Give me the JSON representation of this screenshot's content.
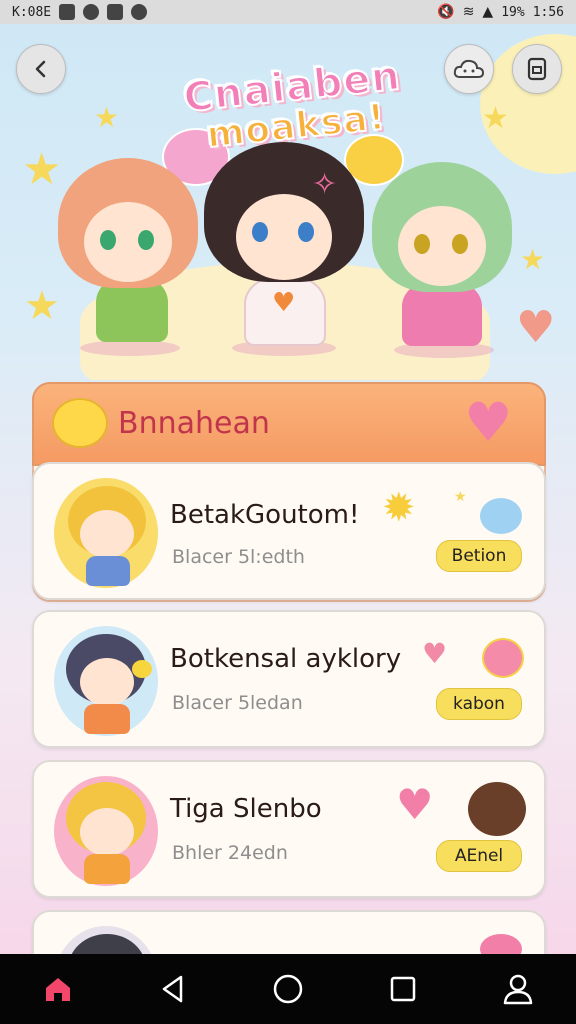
{
  "status_bar": {
    "time_left": "K:08E",
    "battery": "19%",
    "clock": "1:56"
  },
  "header": {
    "title_line1": "Cnaiaben",
    "title_line2": "moaksa!",
    "back_icon": "back-arrow-icon",
    "cloud_icon": "cloud-icon",
    "menu_icon": "document-icon"
  },
  "section": {
    "title": "Bnnahean",
    "heart_icon": "heart-icon"
  },
  "cards": [
    {
      "title": "BetakGoutom!",
      "subtitle": "Blacer 5l:edth",
      "button": "Betion",
      "avatar_color": "#f7d24a"
    },
    {
      "title": "Botkensal ayklory",
      "subtitle": "Blacer 5ledan",
      "button": "kabon",
      "avatar_color": "#bfe4f6"
    },
    {
      "title": "Tiga Slenbo",
      "subtitle": "Bhler 24edn",
      "button": "AEnel",
      "avatar_color": "#f7a9c6"
    }
  ],
  "colors": {
    "accent_pink": "#f27fa8",
    "accent_orange": "#f59a63",
    "button_yellow": "#f8de5d"
  },
  "nav": {
    "home_icon": "home-icon",
    "back_icon": "triangle-back-icon",
    "circle_icon": "home-circle-icon",
    "square_icon": "recents-square-icon",
    "profile_icon": "profile-icon"
  }
}
